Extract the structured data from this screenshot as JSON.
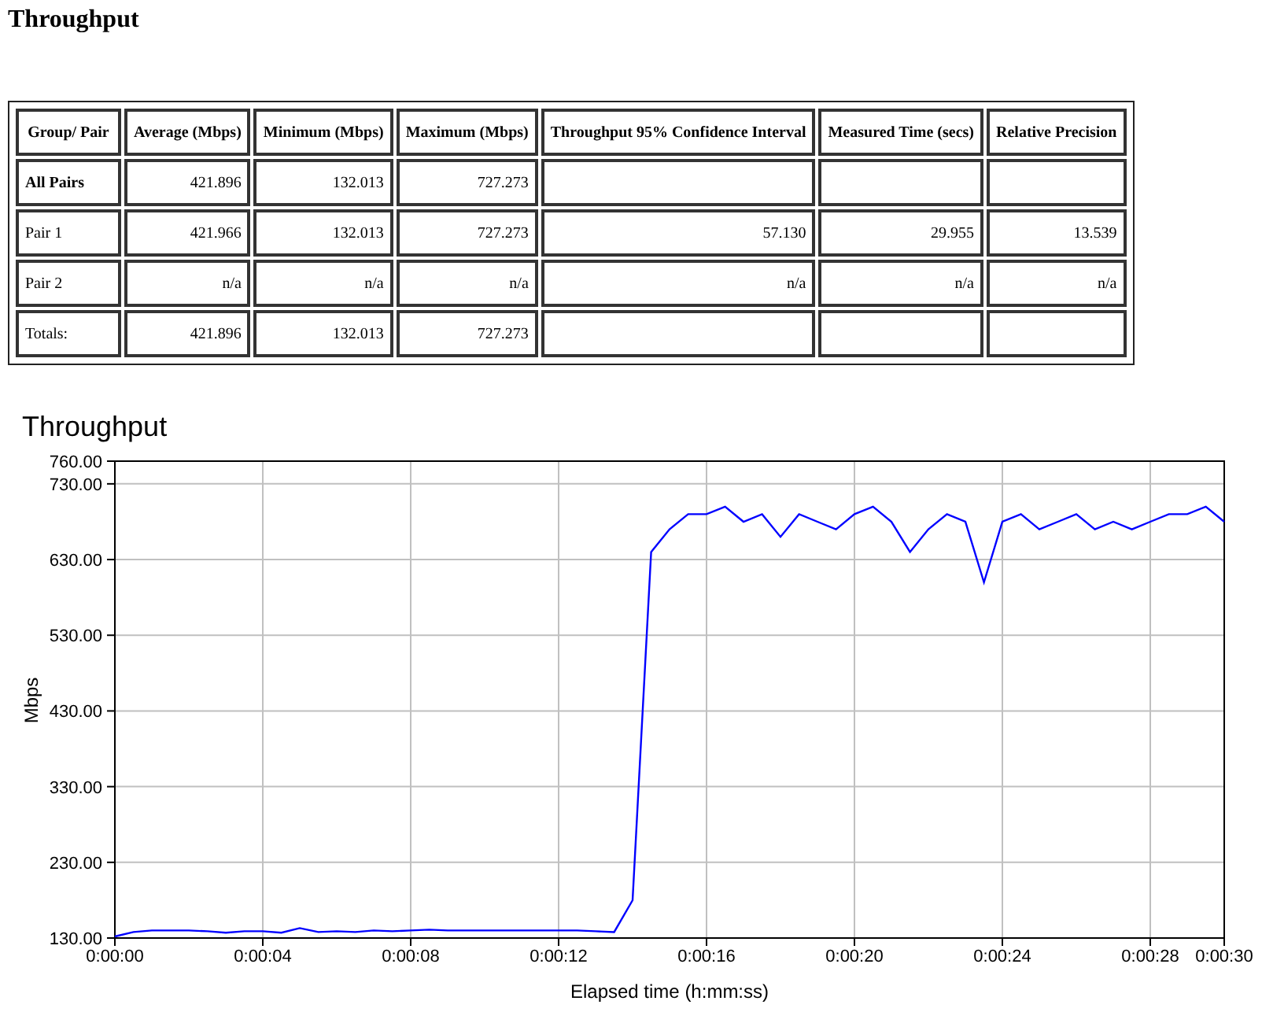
{
  "page_title": "Throughput",
  "table": {
    "columns": [
      "Group/ Pair",
      "Average (Mbps)",
      "Minimum (Mbps)",
      "Maximum (Mbps)",
      "Throughput 95% Confidence Interval",
      "Measured Time (secs)",
      "Relative Precision"
    ],
    "rows": [
      {
        "label_bold": true,
        "cells": [
          "All Pairs",
          "421.896",
          "132.013",
          "727.273",
          "",
          "",
          ""
        ]
      },
      {
        "label_bold": false,
        "cells": [
          "Pair 1",
          "421.966",
          "132.013",
          "727.273",
          "57.130",
          "29.955",
          "13.539"
        ]
      },
      {
        "label_bold": false,
        "cells": [
          "Pair 2",
          "n/a",
          "n/a",
          "n/a",
          "n/a",
          "n/a",
          "n/a"
        ]
      },
      {
        "label_bold": false,
        "cells": [
          "Totals:",
          "421.896",
          "132.013",
          "727.273",
          "",
          "",
          ""
        ]
      }
    ]
  },
  "chart": {
    "chart_data": {
      "type": "line",
      "title": "Throughput",
      "xlabel": "Elapsed time (h:mm:ss)",
      "ylabel": "Mbps",
      "x": [
        0,
        0.5,
        1,
        1.5,
        2,
        2.5,
        3,
        3.5,
        4,
        4.5,
        5,
        5.5,
        6,
        6.5,
        7,
        7.5,
        8,
        8.5,
        9,
        9.5,
        10,
        10.5,
        11,
        11.5,
        12,
        12.5,
        13,
        13.5,
        14,
        14.5,
        15,
        15.5,
        16,
        16.5,
        17,
        17.5,
        18,
        18.5,
        19,
        19.5,
        20,
        20.5,
        21,
        21.5,
        22,
        22.5,
        23,
        23.5,
        24,
        24.5,
        25,
        25.5,
        26,
        26.5,
        27,
        27.5,
        28,
        28.5,
        29,
        29.5,
        30
      ],
      "series": [
        {
          "color": "#0000ff",
          "values": [
            132,
            138,
            140,
            140,
            140,
            139,
            137,
            139,
            139,
            137,
            143,
            138,
            139,
            138,
            140,
            139,
            140,
            141,
            140,
            140,
            140,
            140,
            140,
            140,
            140,
            140,
            139,
            138,
            180,
            640,
            670,
            690,
            690,
            700,
            680,
            690,
            660,
            690,
            680,
            670,
            690,
            700,
            680,
            640,
            670,
            690,
            680,
            600,
            680,
            690,
            670,
            680,
            690,
            670,
            680,
            670,
            680,
            690,
            690,
            700,
            680
          ]
        }
      ],
      "grid": true,
      "xlim": [
        0,
        30
      ],
      "ylim": [
        130,
        760
      ],
      "xticks": [
        {
          "value": 0,
          "label": "0:00:00"
        },
        {
          "value": 4,
          "label": "0:00:04"
        },
        {
          "value": 8,
          "label": "0:00:08"
        },
        {
          "value": 12,
          "label": "0:00:12"
        },
        {
          "value": 16,
          "label": "0:00:16"
        },
        {
          "value": 20,
          "label": "0:00:20"
        },
        {
          "value": 24,
          "label": "0:00:24"
        },
        {
          "value": 28,
          "label": "0:00:28"
        },
        {
          "value": 30,
          "label": "0:00:30"
        }
      ],
      "yticks": [
        {
          "value": 130,
          "label": "130.00"
        },
        {
          "value": 230,
          "label": "230.00"
        },
        {
          "value": 330,
          "label": "330.00"
        },
        {
          "value": 430,
          "label": "430.00"
        },
        {
          "value": 530,
          "label": "530.00"
        },
        {
          "value": 630,
          "label": "630.00"
        },
        {
          "value": 730,
          "label": "730.00"
        },
        {
          "value": 760,
          "label": "760.00"
        }
      ]
    }
  }
}
